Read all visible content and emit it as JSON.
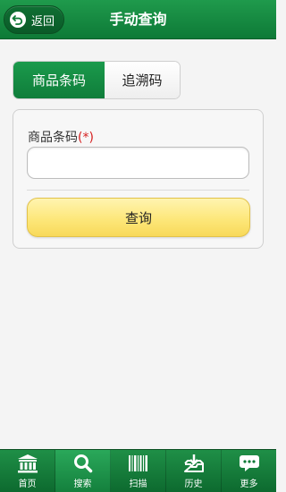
{
  "header": {
    "back_label": "返回",
    "title": "手动查询"
  },
  "tabs": [
    {
      "label": "商品条码",
      "active": true
    },
    {
      "label": "追溯码",
      "active": false
    }
  ],
  "form": {
    "field_label": "商品条码",
    "required_mark": "(*)",
    "input_value": "",
    "input_placeholder": "",
    "submit_label": "查询"
  },
  "bottom_nav": [
    {
      "label": "首页",
      "icon": "bank-icon",
      "active": false
    },
    {
      "label": "搜索",
      "icon": "search-icon",
      "active": true
    },
    {
      "label": "扫描",
      "icon": "barcode-icon",
      "active": false
    },
    {
      "label": "历史",
      "icon": "inbox-download-icon",
      "active": false
    },
    {
      "label": "更多",
      "icon": "chat-bubble-icon",
      "active": false
    }
  ],
  "colors": {
    "brand_green": "#0e7a37",
    "button_yellow": "#fde77a",
    "required_red": "#d62020"
  }
}
